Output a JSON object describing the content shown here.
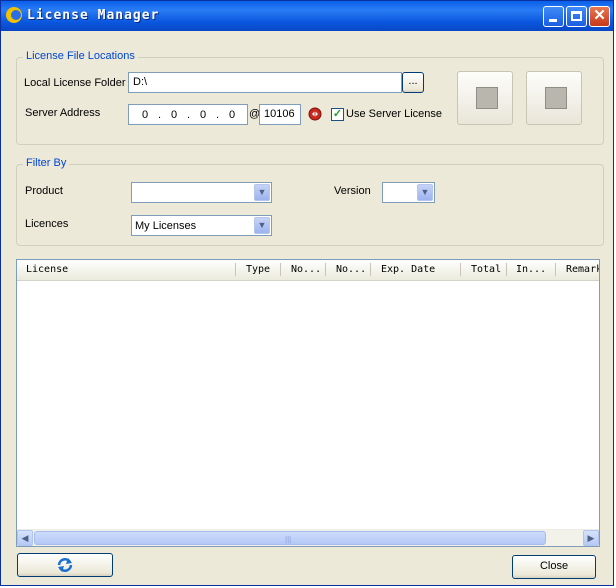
{
  "window": {
    "title": "License Manager"
  },
  "license_file_locations": {
    "group_title": "License File Locations",
    "local_folder_label": "Local License Folder",
    "local_folder_value": "D:\\",
    "browse_label": "...",
    "server_address_label": "Server Address",
    "ip": [
      "0",
      "0",
      "0",
      "0"
    ],
    "at_sign": "@",
    "port": "10106",
    "use_server_label": "Use Server License",
    "use_server_checked": "✓"
  },
  "filter": {
    "group_title": "Filter By",
    "product_label": "Product",
    "product_value": "",
    "version_label": "Version",
    "version_value": "",
    "licences_label": "Licences",
    "licences_value": "My Licenses"
  },
  "table": {
    "columns": [
      "License",
      "Type",
      "No...",
      "No...",
      "Exp. Date",
      "Total",
      "In...",
      "Remark"
    ]
  },
  "footer": {
    "close_label": "Close"
  },
  "colors": {
    "titlebar": "#0a5fe8",
    "group_title": "#0046d5",
    "face": "#ece9d8"
  }
}
